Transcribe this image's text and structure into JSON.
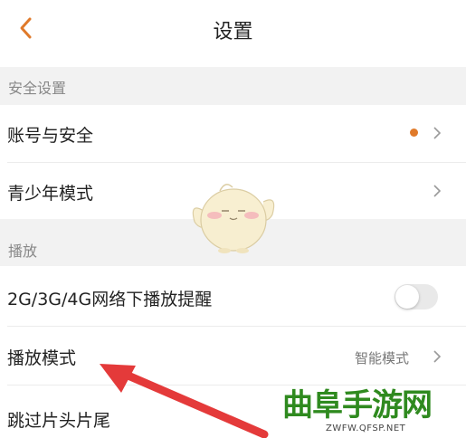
{
  "header": {
    "title": "设置",
    "back_icon": "chevron-left-icon"
  },
  "sections": {
    "security": {
      "title": "安全设置"
    },
    "playback": {
      "title": "播放"
    }
  },
  "rows": {
    "account": {
      "label": "账号与安全",
      "indicator_color": "#e07a2a"
    },
    "youth": {
      "label": "青少年模式"
    },
    "network_alert": {
      "label": "2G/3G/4G网络下播放提醒",
      "toggle_on": false
    },
    "play_mode": {
      "label": "播放模式",
      "value": "智能模式"
    },
    "skip": {
      "label": "跳过片头片尾"
    }
  },
  "watermark": {
    "text": "曲阜手游网",
    "url": "ZWFW.QFSP.NET",
    "color": "#2f8a1f"
  },
  "colors": {
    "accent": "#e07a2a",
    "annotation_arrow": "#e43a3a"
  }
}
